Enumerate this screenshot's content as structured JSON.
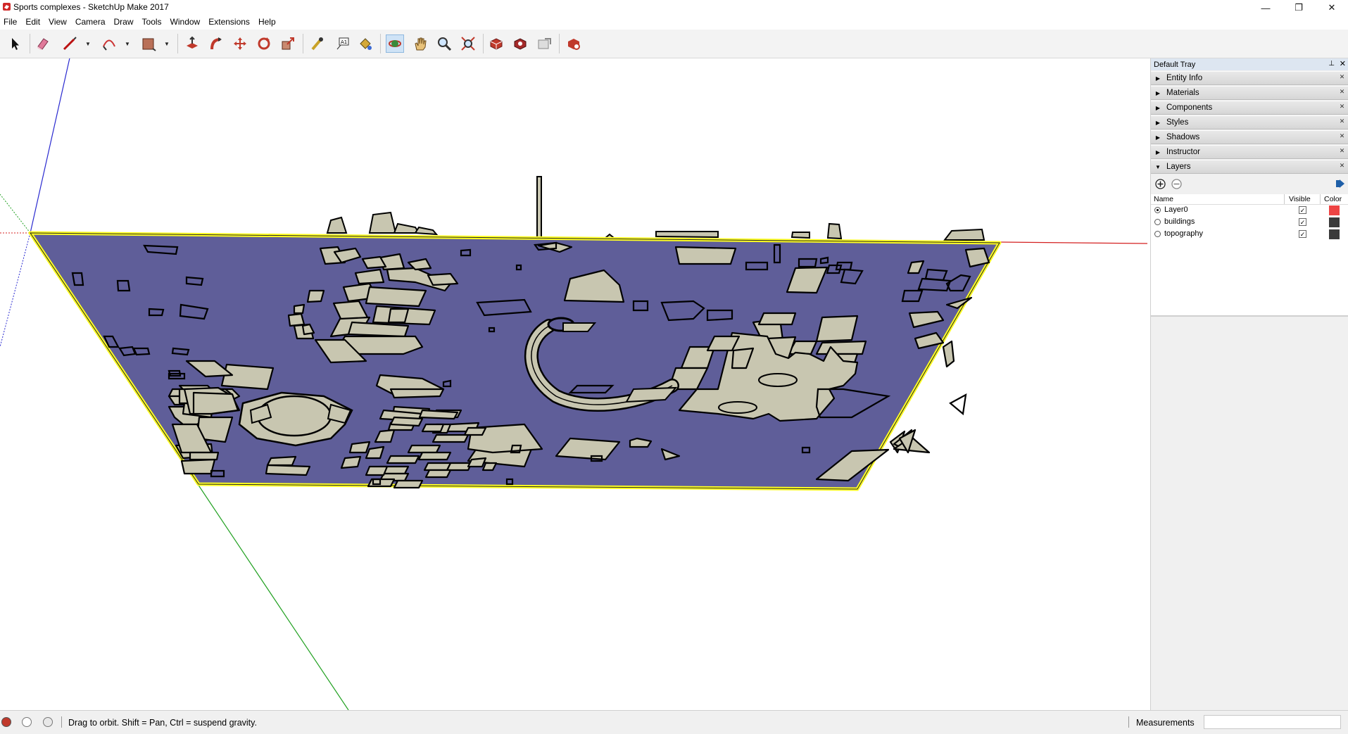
{
  "window": {
    "title": "Sports complexes - SketchUp Make 2017",
    "minimize": "—",
    "maximize": "❐",
    "close": "✕"
  },
  "menu": [
    "File",
    "Edit",
    "View",
    "Camera",
    "Draw",
    "Tools",
    "Window",
    "Extensions",
    "Help"
  ],
  "toolbar": {
    "tools": [
      "select",
      "eraser",
      "line",
      "arc",
      "rectangle",
      "push-pull",
      "follow-me",
      "move",
      "rotate",
      "scale",
      "tape-measure",
      "text",
      "paint-bucket",
      "orbit",
      "pan",
      "zoom",
      "zoom-extents",
      "3d-warehouse",
      "extension-warehouse",
      "layout",
      "extension-manager"
    ],
    "active_tool": "orbit"
  },
  "tray": {
    "title": "Default Tray",
    "pin": "📌",
    "panels": [
      {
        "label": "Entity Info",
        "expanded": false
      },
      {
        "label": "Materials",
        "expanded": false
      },
      {
        "label": "Components",
        "expanded": false
      },
      {
        "label": "Styles",
        "expanded": false
      },
      {
        "label": "Shadows",
        "expanded": false
      },
      {
        "label": "Instructor",
        "expanded": false
      },
      {
        "label": "Layers",
        "expanded": true
      }
    ],
    "layers": {
      "columns": {
        "name": "Name",
        "visible": "Visible",
        "color": "Color"
      },
      "rows": [
        {
          "name": "Layer0",
          "current": true,
          "visible": true,
          "color": "#ee4444"
        },
        {
          "name": "buildings",
          "current": false,
          "visible": true,
          "color": "#3a3a3a"
        },
        {
          "name": "topography",
          "current": false,
          "visible": true,
          "color": "#3a3a3a"
        }
      ]
    }
  },
  "status": {
    "message": "Drag to orbit. Shift = Pan, Ctrl = suspend gravity.",
    "measurements_label": "Measurements",
    "measurements_value": ""
  },
  "scene": {
    "ground_color": "#5f5e99",
    "building_fill": "#c8c6b0",
    "selection_color": "#ffff22",
    "axis_colors": {
      "red": "#d42020",
      "green": "#20a020",
      "blue": "#2020c8"
    }
  }
}
